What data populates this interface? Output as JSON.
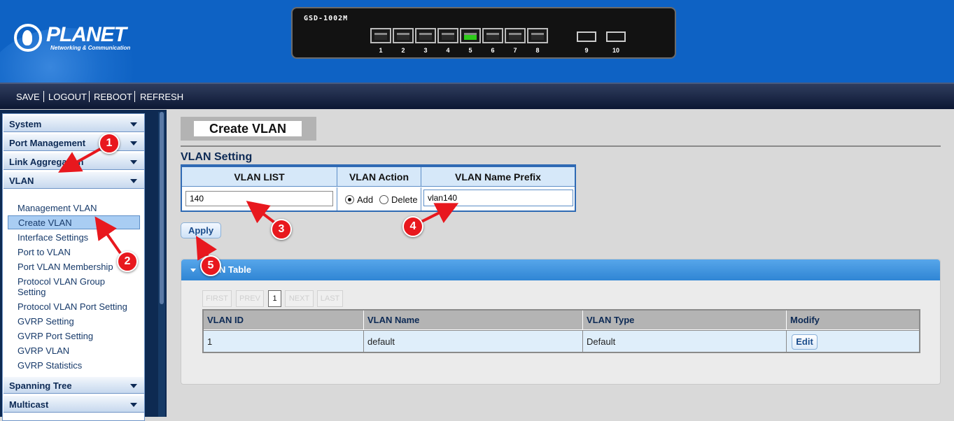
{
  "header": {
    "brand": "PLANET",
    "tagline": "Networking & Communication",
    "device_model": "GSD-1002M",
    "ports": [
      "1",
      "2",
      "3",
      "4",
      "5",
      "6",
      "7",
      "8"
    ],
    "active_port": "5",
    "sfp_ports": [
      "9",
      "10"
    ]
  },
  "toolbar": {
    "save": "SAVE",
    "logout": "LOGOUT",
    "reboot": "REBOOT",
    "refresh": "REFRESH"
  },
  "sidebar": {
    "sections": [
      "System",
      "Port Management",
      "Link Aggregation",
      "VLAN",
      "Spanning Tree",
      "Multicast"
    ],
    "vlan_items": [
      "Management VLAN",
      "Create VLAN",
      "Interface Settings",
      "Port to VLAN",
      "Port VLAN Membership",
      "Protocol VLAN Group Setting",
      "Protocol VLAN Port Setting",
      "GVRP Setting",
      "GVRP Port Setting",
      "GVRP VLAN",
      "GVRP Statistics"
    ],
    "selected_item": "Create VLAN"
  },
  "page": {
    "title": "Create VLAN",
    "section_title": "VLAN Setting",
    "columns": [
      "VLAN LIST",
      "VLAN Action",
      "VLAN Name Prefix"
    ],
    "vlan_list_value": "140",
    "action_add": "Add",
    "action_delete": "Delete",
    "action_selected": "Add",
    "name_prefix_value": "vlan140",
    "apply_label": "Apply"
  },
  "vlan_table": {
    "title": "VLAN Table",
    "pager": [
      "FIRST",
      "PREV",
      "1",
      "NEXT",
      "LAST"
    ],
    "current_page": "1",
    "headers": [
      "VLAN ID",
      "VLAN Name",
      "VLAN Type",
      "Modify"
    ],
    "rows": [
      {
        "id": "1",
        "name": "default",
        "type": "Default",
        "modify": "Edit"
      }
    ]
  },
  "annotations": [
    "1",
    "2",
    "3",
    "4",
    "5"
  ],
  "colors": {
    "header_blue": "#0e62c4",
    "annotation_red": "#e8181e",
    "sidebar_dark": "#0e2a52"
  }
}
